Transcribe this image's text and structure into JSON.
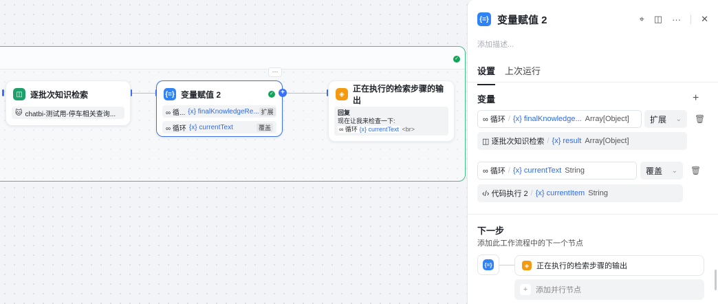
{
  "canvas": {
    "node_batch": {
      "title": "逐批次知识检索",
      "kb_label": "chatbi-测试用-停车相关查询..."
    },
    "node_assign": {
      "title": "变量赋值 2",
      "more": "···",
      "rows": [
        {
          "src": "∞ 循...",
          "var": "{x} finalKnowledgeRe...",
          "tag": "扩展"
        },
        {
          "src": "∞ 循环",
          "var": "{x} currentText",
          "tag": "覆盖"
        }
      ]
    },
    "node_output": {
      "title": "正在执行的检索步骤的输出",
      "reply_label": "回复",
      "line1": "现在让我来检查一下:",
      "line2_src": "∞ 循环",
      "line2_var": "{x} currentText",
      "line2_tail": "<br>"
    }
  },
  "panel": {
    "title": "变量赋值 2",
    "description_placeholder": "添加描述...",
    "tabs": [
      "设置",
      "上次运行"
    ],
    "variables_title": "变量",
    "add": "+",
    "groups": [
      {
        "target_src": "∞ 循环",
        "target_var": "{x} finalKnowledge...",
        "target_type": "Array[Object]",
        "mode": "扩展",
        "value_src": "◫ 逐批次知识检索",
        "value_var": "{x} result",
        "value_type": "Array[Object]"
      },
      {
        "target_src": "∞ 循环",
        "target_var": "{x} currentText",
        "target_type": "String",
        "mode": "覆盖",
        "value_src": "‹/› 代码执行 2",
        "value_var": "{x} currentItem",
        "value_type": "String"
      }
    ],
    "next_title": "下一步",
    "next_desc": "添加此工作流程中的下一个节点",
    "next_node": "正在执行的检索步骤的输出",
    "add_parallel": "添加并行节点"
  },
  "colors": {
    "accent": "#3b70f5",
    "loop_border": "#44c081",
    "orange": "#f39a10",
    "green": "#1ea06a"
  },
  "icons": [
    "knowledge-icon",
    "assign-icon",
    "answer-icon",
    "check-icon",
    "plus-icon",
    "close-icon",
    "trash-icon",
    "chevron-down-icon",
    "locate-icon",
    "book-icon",
    "more-icon"
  ]
}
